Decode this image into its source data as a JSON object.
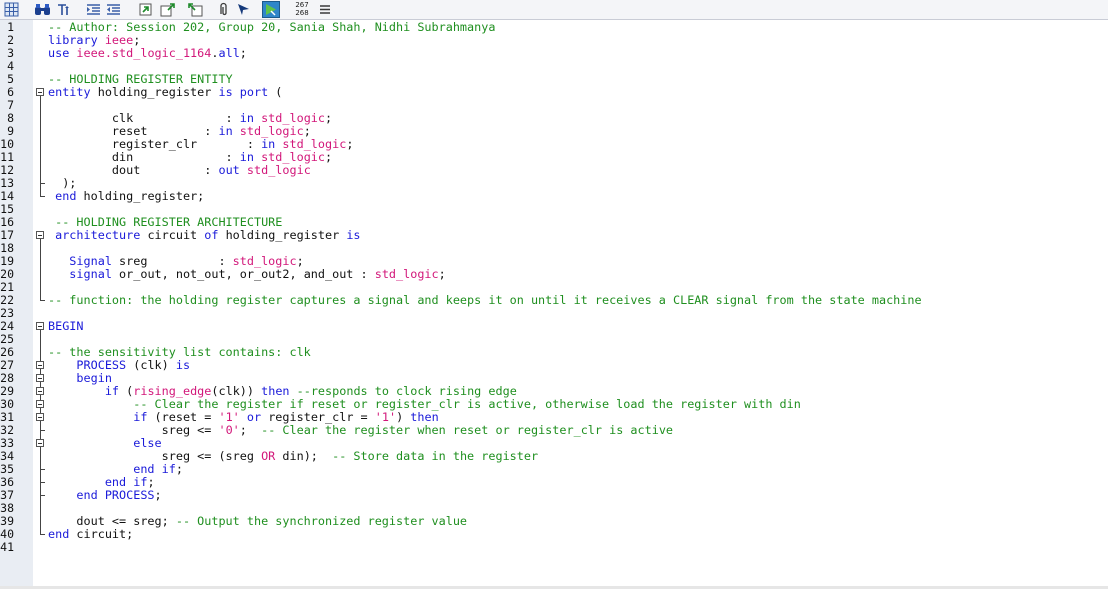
{
  "toolbar": {
    "icons": [
      "grid-icon",
      "binoculars-icon",
      "matching-brace-icon",
      "indent-icon",
      "outdent-icon",
      "collapse-icon",
      "expand-up-icon",
      "expand-down-icon",
      "paperclip-icon",
      "arrow-icon",
      "run-icon",
      "line-counter",
      "menu-icon"
    ],
    "counter_top": "267",
    "counter_bottom": "268"
  },
  "colors": {
    "keyword": "#1a1ad9",
    "type": "#d2177a",
    "comment": "#1f8f1f",
    "text": "#111111",
    "gutter": "#e9edf3"
  },
  "lines": [
    {
      "n": "1",
      "tokens": [
        {
          "t": "cm",
          "v": "-- Author: Session 202, Group 20, Sania Shah, Nidhi Subrahmanya"
        }
      ]
    },
    {
      "n": "2",
      "tokens": [
        {
          "t": "kw",
          "v": "library "
        },
        {
          "t": "ty",
          "v": "ieee"
        },
        {
          "t": "id",
          "v": ";"
        }
      ]
    },
    {
      "n": "3",
      "tokens": [
        {
          "t": "kw",
          "v": "use "
        },
        {
          "t": "ty",
          "v": "ieee.std_logic_1164"
        },
        {
          "t": "id",
          "v": "."
        },
        {
          "t": "kw",
          "v": "all"
        },
        {
          "t": "id",
          "v": ";"
        }
      ]
    },
    {
      "n": "4",
      "tokens": []
    },
    {
      "n": "5",
      "tokens": [
        {
          "t": "cm",
          "v": "-- HOLDING REGISTER ENTITY"
        }
      ]
    },
    {
      "n": "6",
      "tokens": [
        {
          "t": "kw",
          "v": "entity "
        },
        {
          "t": "id",
          "v": "holding_register "
        },
        {
          "t": "kw",
          "v": "is "
        },
        {
          "t": "kw",
          "v": "port "
        },
        {
          "t": "id",
          "v": "("
        }
      ]
    },
    {
      "n": "7",
      "tokens": []
    },
    {
      "n": "8",
      "tokens": [
        {
          "t": "id",
          "v": "         clk             : "
        },
        {
          "t": "kw",
          "v": "in "
        },
        {
          "t": "ty",
          "v": "std_logic"
        },
        {
          "t": "id",
          "v": ";"
        }
      ]
    },
    {
      "n": "9",
      "tokens": [
        {
          "t": "id",
          "v": "         reset        : "
        },
        {
          "t": "kw",
          "v": "in "
        },
        {
          "t": "ty",
          "v": "std_logic"
        },
        {
          "t": "id",
          "v": ";"
        }
      ]
    },
    {
      "n": "10",
      "tokens": [
        {
          "t": "id",
          "v": "         register_clr       : "
        },
        {
          "t": "kw",
          "v": "in "
        },
        {
          "t": "ty",
          "v": "std_logic"
        },
        {
          "t": "id",
          "v": ";"
        }
      ]
    },
    {
      "n": "11",
      "tokens": [
        {
          "t": "id",
          "v": "         din             : "
        },
        {
          "t": "kw",
          "v": "in "
        },
        {
          "t": "ty",
          "v": "std_logic"
        },
        {
          "t": "id",
          "v": ";"
        }
      ]
    },
    {
      "n": "12",
      "tokens": [
        {
          "t": "id",
          "v": "         dout         : "
        },
        {
          "t": "kw",
          "v": "out "
        },
        {
          "t": "ty",
          "v": "std_logic"
        }
      ]
    },
    {
      "n": "13",
      "tokens": [
        {
          "t": "id",
          "v": "  );"
        }
      ]
    },
    {
      "n": "14",
      "tokens": [
        {
          "t": "id",
          "v": " "
        },
        {
          "t": "kw",
          "v": "end "
        },
        {
          "t": "id",
          "v": "holding_register;"
        }
      ]
    },
    {
      "n": "15",
      "tokens": []
    },
    {
      "n": "16",
      "tokens": [
        {
          "t": "cm",
          "v": " -- HOLDING REGISTER ARCHITECTURE"
        }
      ]
    },
    {
      "n": "17",
      "tokens": [
        {
          "t": "kw",
          "v": " architecture "
        },
        {
          "t": "id",
          "v": "circuit "
        },
        {
          "t": "kw",
          "v": "of "
        },
        {
          "t": "id",
          "v": "holding_register "
        },
        {
          "t": "kw",
          "v": "is"
        }
      ]
    },
    {
      "n": "18",
      "tokens": []
    },
    {
      "n": "19",
      "tokens": [
        {
          "t": "kw",
          "v": "   Signal "
        },
        {
          "t": "id",
          "v": "sreg          : "
        },
        {
          "t": "ty",
          "v": "std_logic"
        },
        {
          "t": "id",
          "v": ";"
        }
      ]
    },
    {
      "n": "20",
      "tokens": [
        {
          "t": "kw",
          "v": "   signal "
        },
        {
          "t": "id",
          "v": "or_out, not_out, or_out2, and_out : "
        },
        {
          "t": "ty",
          "v": "std_logic"
        },
        {
          "t": "id",
          "v": ";"
        }
      ]
    },
    {
      "n": "21",
      "tokens": []
    },
    {
      "n": "22",
      "tokens": [
        {
          "t": "cm",
          "v": "-- function: the holding register captures a signal and keeps it on until it receives a CLEAR signal from the state machine"
        }
      ]
    },
    {
      "n": "23",
      "tokens": []
    },
    {
      "n": "24",
      "tokens": [
        {
          "t": "kw",
          "v": "BEGIN"
        }
      ]
    },
    {
      "n": "25",
      "tokens": []
    },
    {
      "n": "26",
      "tokens": [
        {
          "t": "cm",
          "v": "-- the sensitivity list contains: clk"
        }
      ]
    },
    {
      "n": "27",
      "tokens": [
        {
          "t": "kw",
          "v": "    PROCESS "
        },
        {
          "t": "id",
          "v": "(clk) "
        },
        {
          "t": "kw",
          "v": "is"
        }
      ]
    },
    {
      "n": "28",
      "tokens": [
        {
          "t": "kw",
          "v": "    begin"
        }
      ]
    },
    {
      "n": "29",
      "tokens": [
        {
          "t": "kw",
          "v": "        if "
        },
        {
          "t": "id",
          "v": "("
        },
        {
          "t": "ty",
          "v": "rising_edge"
        },
        {
          "t": "id",
          "v": "(clk)) "
        },
        {
          "t": "kw",
          "v": "then "
        },
        {
          "t": "cm",
          "v": "--responds to clock rising edge"
        }
      ]
    },
    {
      "n": "30",
      "tokens": [
        {
          "t": "cm",
          "v": "            -- Clear the register if reset or register_clr is active, otherwise load the register with din"
        }
      ]
    },
    {
      "n": "31",
      "tokens": [
        {
          "t": "kw",
          "v": "            if "
        },
        {
          "t": "id",
          "v": "(reset = "
        },
        {
          "t": "ty",
          "v": "'1' "
        },
        {
          "t": "kw",
          "v": "or "
        },
        {
          "t": "id",
          "v": "register_clr = "
        },
        {
          "t": "ty",
          "v": "'1'"
        },
        {
          "t": "id",
          "v": ") "
        },
        {
          "t": "kw",
          "v": "then"
        }
      ]
    },
    {
      "n": "32",
      "tokens": [
        {
          "t": "id",
          "v": "                sreg <= "
        },
        {
          "t": "ty",
          "v": "'0'"
        },
        {
          "t": "id",
          "v": ";  "
        },
        {
          "t": "cm",
          "v": "-- Clear the register when reset or register_clr is active"
        }
      ]
    },
    {
      "n": "33",
      "tokens": [
        {
          "t": "kw",
          "v": "            else"
        }
      ]
    },
    {
      "n": "34",
      "tokens": [
        {
          "t": "id",
          "v": "                sreg <= (sreg "
        },
        {
          "t": "ty",
          "v": "OR "
        },
        {
          "t": "id",
          "v": "din);  "
        },
        {
          "t": "cm",
          "v": "-- Store data in the register"
        }
      ]
    },
    {
      "n": "35",
      "tokens": [
        {
          "t": "kw",
          "v": "            end if"
        },
        {
          "t": "id",
          "v": ";"
        }
      ]
    },
    {
      "n": "36",
      "tokens": [
        {
          "t": "kw",
          "v": "        end if"
        },
        {
          "t": "id",
          "v": ";"
        }
      ]
    },
    {
      "n": "37",
      "tokens": [
        {
          "t": "kw",
          "v": "    end PROCESS"
        },
        {
          "t": "id",
          "v": ";"
        }
      ]
    },
    {
      "n": "38",
      "tokens": []
    },
    {
      "n": "39",
      "tokens": [
        {
          "t": "id",
          "v": "    dout <= sreg; "
        },
        {
          "t": "cm",
          "v": "-- Output the synchronized register value"
        }
      ]
    },
    {
      "n": "40",
      "tokens": [
        {
          "t": "kw",
          "v": "end "
        },
        {
          "t": "id",
          "v": "circuit;"
        }
      ]
    },
    {
      "n": "41",
      "tokens": []
    }
  ]
}
